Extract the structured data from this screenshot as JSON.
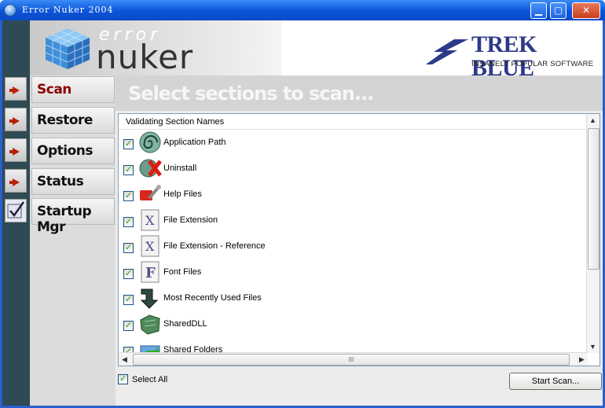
{
  "window": {
    "title": "Error Nuker 2004",
    "min_label": "▁",
    "max_label": "▢",
    "close_label": "✕"
  },
  "header": {
    "logo_top": "error",
    "logo_bottom": "nuker",
    "brand_title": "TREK BLUE",
    "brand_subtitle": "INSANELY POPULAR SOFTWARE"
  },
  "nav": {
    "items": [
      {
        "label": "Scan",
        "icon": "arrow-right-icon",
        "active": true
      },
      {
        "label": "Restore",
        "icon": "arrow-right-icon",
        "active": false
      },
      {
        "label": "Options",
        "icon": "arrow-right-icon",
        "active": false
      },
      {
        "label": "Status",
        "icon": "arrow-right-icon",
        "active": false
      },
      {
        "label": "Startup Mgr",
        "icon": "checkmark-icon",
        "active": false
      }
    ]
  },
  "main": {
    "banner": "Select sections to scan...",
    "list_header": "Validating Section Names",
    "sections": [
      {
        "label": "Application Path",
        "checked": true,
        "icon": "shell-spiral-icon"
      },
      {
        "label": "Uninstall",
        "checked": true,
        "icon": "uninstall-x-icon"
      },
      {
        "label": "Help Files",
        "checked": true,
        "icon": "help-wrench-icon"
      },
      {
        "label": "File Extension",
        "checked": true,
        "icon": "file-extension-icon"
      },
      {
        "label": "File Extension - Reference",
        "checked": true,
        "icon": "file-extension-icon"
      },
      {
        "label": "Font Files",
        "checked": true,
        "icon": "font-file-icon"
      },
      {
        "label": "Most Recently Used Files",
        "checked": true,
        "icon": "recent-arrow-icon"
      },
      {
        "label": "SharedDLL",
        "checked": true,
        "icon": "shared-dll-icon"
      },
      {
        "label": "Shared Folders",
        "checked": true,
        "icon": "shared-folder-icon"
      }
    ],
    "select_all_label": "Select All",
    "start_button": "Start Scan...",
    "colors": {
      "active_nav": "#8a0000",
      "title_bar": "#0a54d8",
      "brand": "#2d3a8a"
    }
  }
}
